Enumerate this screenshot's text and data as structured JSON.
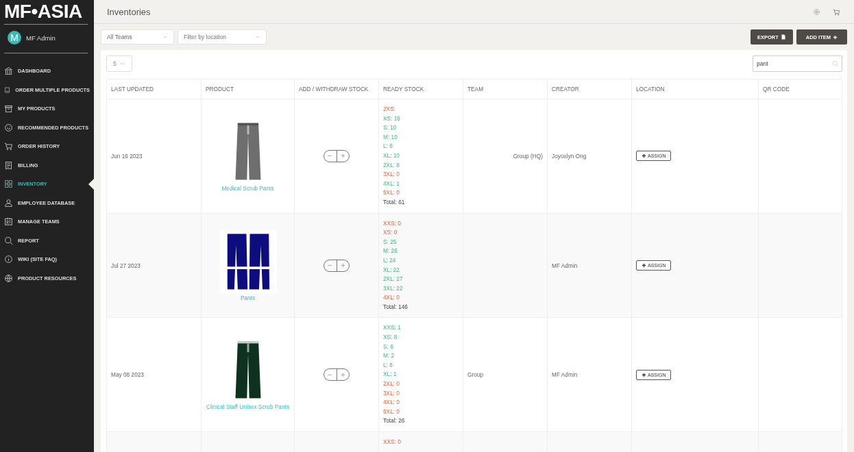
{
  "sidebar": {
    "logo": "MF•ASIA",
    "user": {
      "avatar_letter": "M",
      "name": "MF Admin"
    },
    "items": [
      {
        "label": "DASHBOARD",
        "selected": false
      },
      {
        "label": "ORDER MULTIPLE PRODUCTS",
        "selected": false
      },
      {
        "label": "MY PRODUCTS",
        "selected": false
      },
      {
        "label": "RECOMMENDED PRODUCTS",
        "selected": false
      },
      {
        "label": "ORDER HISTORY",
        "selected": false
      },
      {
        "label": "BILLING",
        "selected": false
      },
      {
        "label": "INVENTORY",
        "selected": true
      },
      {
        "label": "EMPLOYEE DATABASE",
        "selected": false
      },
      {
        "label": "MANAGE TEAMS",
        "selected": false
      },
      {
        "label": "REPORT",
        "selected": false
      },
      {
        "label": "WIKI (SITE FAQ)",
        "selected": false
      },
      {
        "label": "PRODUCT RESOURCES",
        "selected": false
      }
    ]
  },
  "header": {
    "title": "Inventories"
  },
  "filters": {
    "team": {
      "value": "All Teams"
    },
    "location": {
      "placeholder": "Filter by location"
    }
  },
  "buttons": {
    "export": "EXPORT",
    "add_item": "ADD ITEM"
  },
  "page_size": {
    "value": "5"
  },
  "search": {
    "value": "pant"
  },
  "table": {
    "columns": [
      "LAST UPDATED",
      "PRODUCT",
      "ADD / WITHDRAW STOCK",
      "READY STOCK",
      "TEAM",
      "CREATOR",
      "LOCATION",
      "QR CODE"
    ],
    "rows": [
      {
        "last_updated": "Jun 16 2023",
        "product": {
          "kind": "picture",
          "name": "Medical Scrub Pants"
        },
        "team": "Group (HQ)",
        "creator": "Joycelyn Ong",
        "assign": "ASSIGN",
        "total": "Total: 61",
        "stock": [
          {
            "text": "2XS:",
            "available": false
          },
          {
            "text": "XS: 16",
            "available": true
          },
          {
            "text": "S: 10",
            "available": true
          },
          {
            "text": "M: 10",
            "available": true
          },
          {
            "text": "L: 6",
            "available": true
          },
          {
            "text": "XL: 10",
            "available": true
          },
          {
            "text": "2XL: 8",
            "available": true
          },
          {
            "text": "3XL: 0",
            "available": false
          },
          {
            "text": "4XL: 1",
            "available": true
          },
          {
            "text": "5XL: 0",
            "available": false
          }
        ]
      },
      {
        "last_updated": "Jul 27 2023",
        "product": {
          "kind": "picture",
          "name": "Pants"
        },
        "creator": "MF Admin",
        "assign": "ASSIGN",
        "total": "Total: 146",
        "stock": [
          {
            "text": "XXS: 0",
            "available": false
          },
          {
            "text": "XS: 0",
            "available": false
          },
          {
            "text": "S: 25",
            "available": true
          },
          {
            "text": "M: 26",
            "available": true
          },
          {
            "text": "L: 24",
            "available": true
          },
          {
            "text": "XL: 22",
            "available": true
          },
          {
            "text": "2XL: 27",
            "available": true
          },
          {
            "text": "3XL: 22",
            "available": true
          },
          {
            "text": "4XL: 0",
            "available": false
          }
        ]
      },
      {
        "last_updated": "May 08 2023",
        "product": {
          "kind": "picture",
          "name": "Clinical Staff Unisex Scrub Pants"
        },
        "team": "Group",
        "creator": "MF Admin",
        "assign": "ASSIGN",
        "total": "Total: 26",
        "stock": [
          {
            "text": "XXS: 1",
            "available": true
          },
          {
            "text": "XS: 8",
            "available": true
          },
          {
            "text": "S: 6",
            "available": true
          },
          {
            "text": "M: 2",
            "available": true
          },
          {
            "text": "L: 8",
            "available": true
          },
          {
            "text": "XL: 1",
            "available": true
          },
          {
            "text": "2XL: 0",
            "available": false
          },
          {
            "text": "3XL: 0",
            "available": false
          },
          {
            "text": "4XL: 0",
            "available": false
          },
          {
            "text": "5XL: 0",
            "available": false
          }
        ]
      },
      {
        "stock": [
          {
            "text": "XXS: 0",
            "available": false
          }
        ]
      }
    ]
  }
}
